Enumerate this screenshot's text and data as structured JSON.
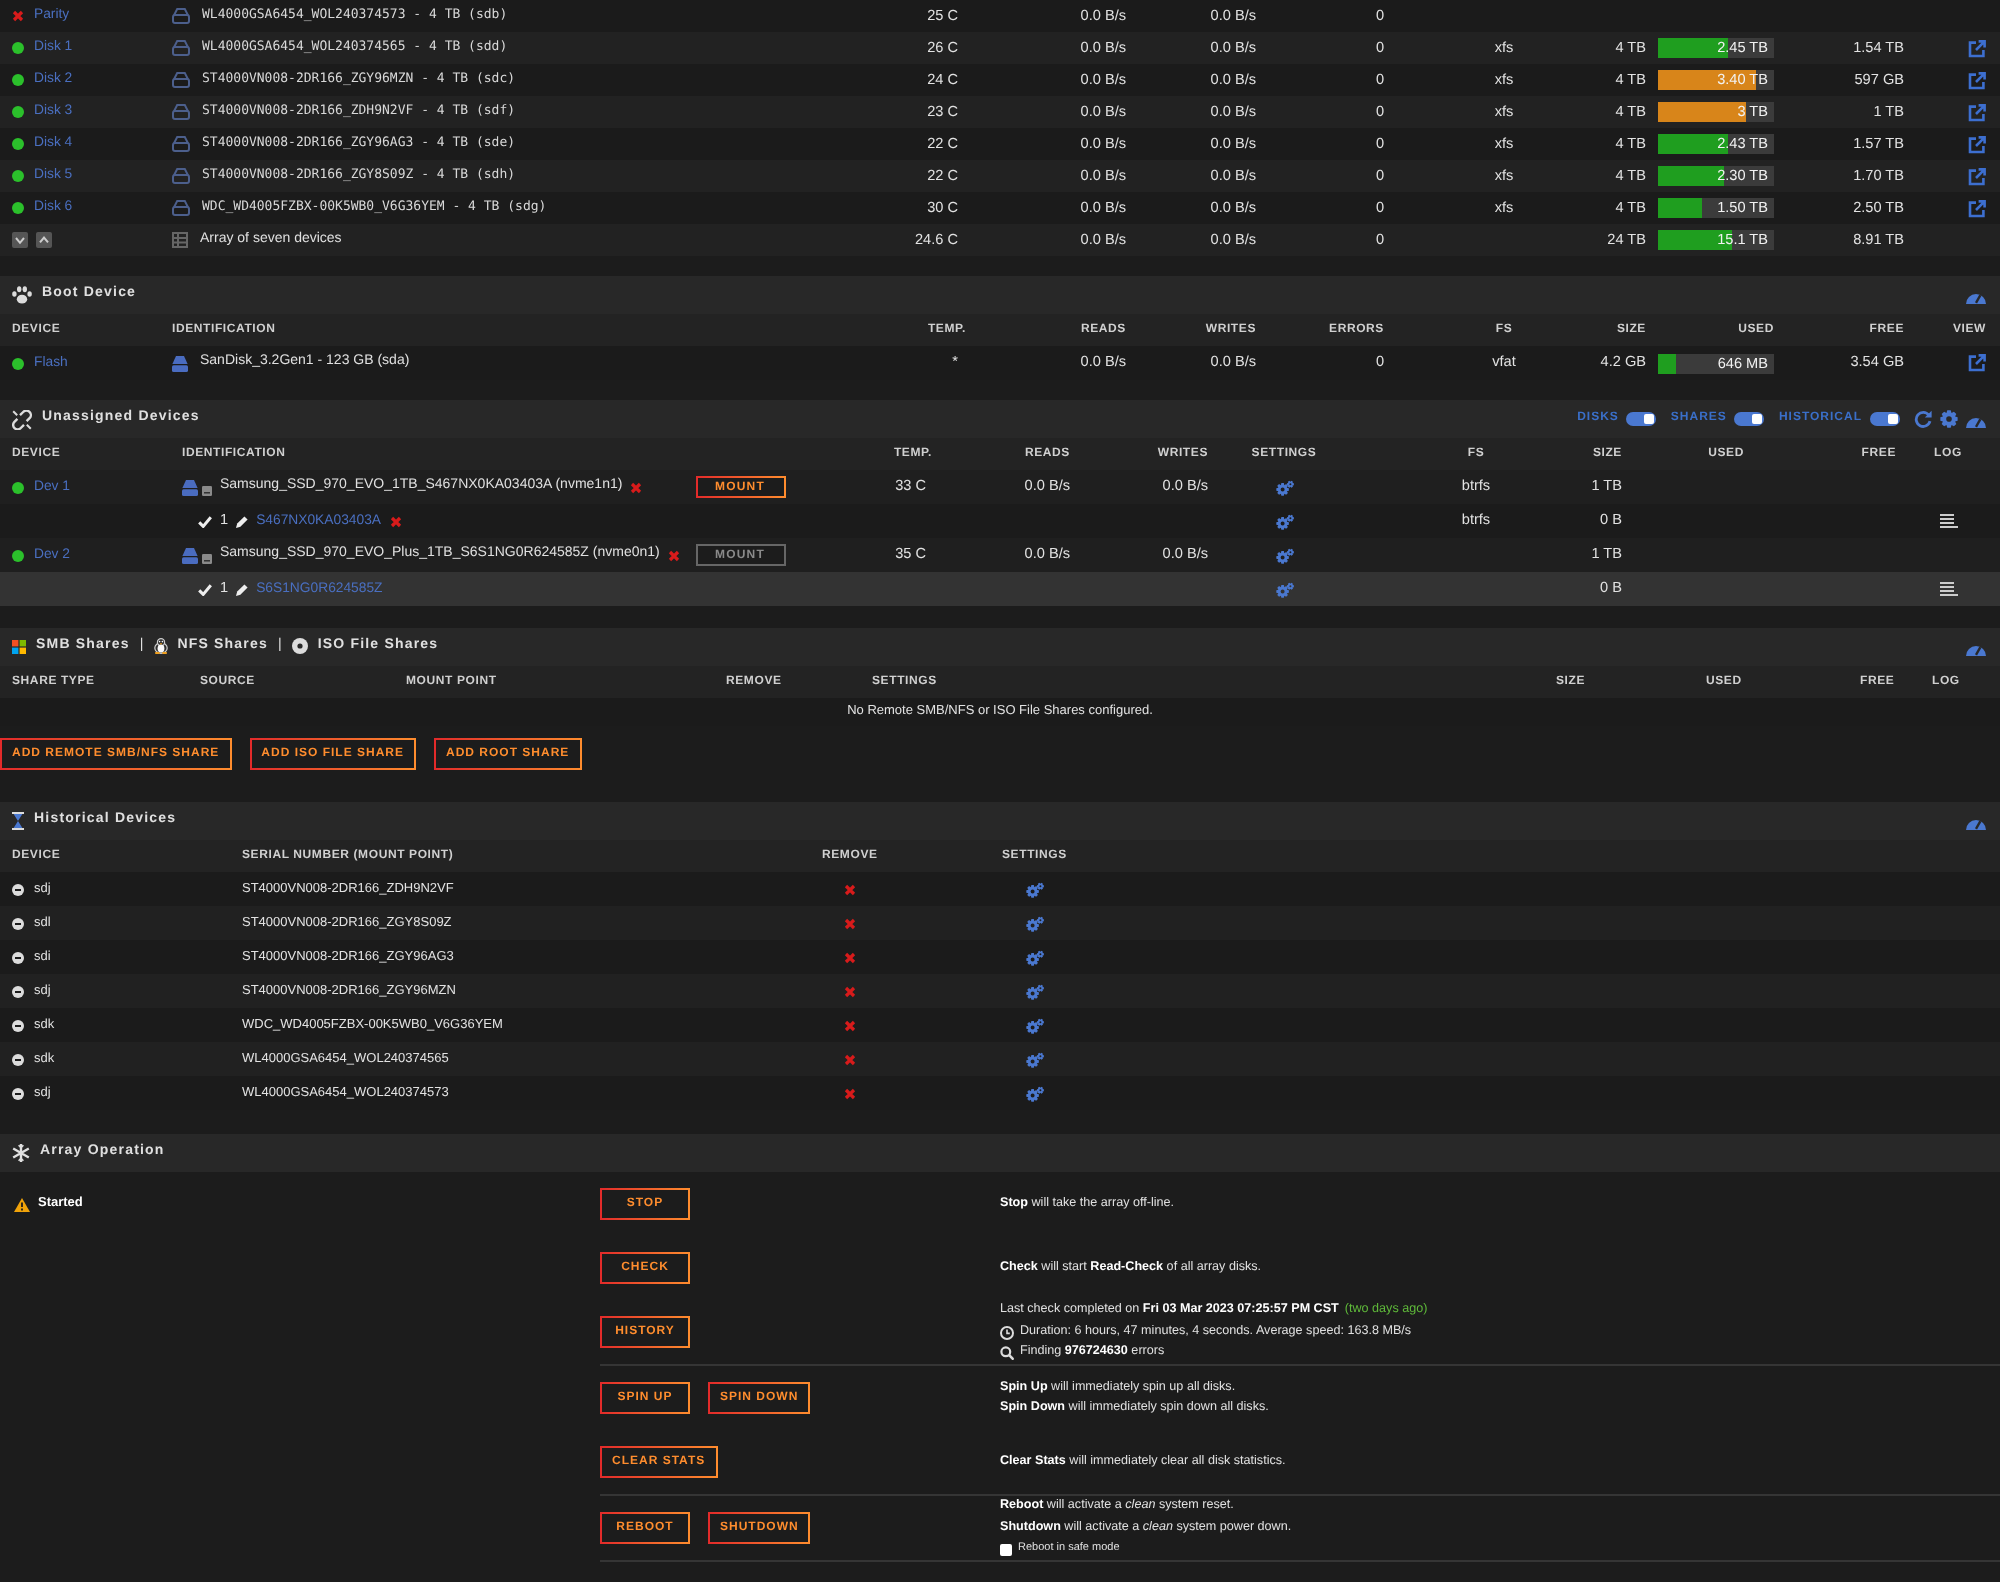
{
  "array": {
    "rows": [
      {
        "device": "Parity",
        "fault": true,
        "identification": "WL4000GSA6454_WOL240374573 - 4 TB (sdb)",
        "temp": "25 C",
        "reads": "0.0 B/s",
        "writes": "0.0 B/s",
        "errors": "0",
        "view": false
      },
      {
        "device": "Disk 1",
        "fault": false,
        "identification": "WL4000GSA6454_WOL240374565 - 4 TB (sdd)",
        "temp": "26 C",
        "reads": "0.0 B/s",
        "writes": "0.0 B/s",
        "errors": "0",
        "fs": "xfs",
        "size": "4 TB",
        "used": {
          "text": "2.45 TB",
          "level": 0.61,
          "color": "#1f9e1f"
        },
        "free": "1.54 TB",
        "view": true
      },
      {
        "device": "Disk 2",
        "fault": false,
        "identification": "ST4000VN008-2DR166_ZGY96MZN - 4 TB (sdc)",
        "temp": "24 C",
        "reads": "0.0 B/s",
        "writes": "0.0 B/s",
        "errors": "0",
        "fs": "xfs",
        "size": "4 TB",
        "used": {
          "text": "3.40 TB",
          "level": 0.85,
          "color": "#d8851a"
        },
        "free": "597 GB",
        "view": true
      },
      {
        "device": "Disk 3",
        "fault": false,
        "identification": "ST4000VN008-2DR166_ZDH9N2VF - 4 TB (sdf)",
        "temp": "23 C",
        "reads": "0.0 B/s",
        "writes": "0.0 B/s",
        "errors": "0",
        "fs": "xfs",
        "size": "4 TB",
        "used": {
          "text": "3 TB",
          "level": 0.75,
          "color": "#d8851a"
        },
        "free": "1 TB",
        "view": true
      },
      {
        "device": "Disk 4",
        "fault": false,
        "identification": "ST4000VN008-2DR166_ZGY96AG3 - 4 TB (sde)",
        "temp": "22 C",
        "reads": "0.0 B/s",
        "writes": "0.0 B/s",
        "errors": "0",
        "fs": "xfs",
        "size": "4 TB",
        "used": {
          "text": "2.43 TB",
          "level": 0.61,
          "color": "#1f9e1f"
        },
        "free": "1.57 TB",
        "view": true
      },
      {
        "device": "Disk 5",
        "fault": false,
        "identification": "ST4000VN008-2DR166_ZGY8S09Z - 4 TB (sdh)",
        "temp": "22 C",
        "reads": "0.0 B/s",
        "writes": "0.0 B/s",
        "errors": "0",
        "fs": "xfs",
        "size": "4 TB",
        "used": {
          "text": "2.30 TB",
          "level": 0.575,
          "color": "#1f9e1f"
        },
        "free": "1.70 TB",
        "view": true
      },
      {
        "device": "Disk 6",
        "fault": false,
        "identification": "WDC_WD4005FZBX-00K5WB0_V6G36YEM - 4 TB (sdg)",
        "temp": "30 C",
        "reads": "0.0 B/s",
        "writes": "0.0 B/s",
        "errors": "0",
        "fs": "xfs",
        "size": "4 TB",
        "used": {
          "text": "1.50 TB",
          "level": 0.375,
          "color": "#1f9e1f"
        },
        "free": "2.50 TB",
        "view": true
      }
    ],
    "total": {
      "label": "Array of seven devices",
      "temp": "24.6 C",
      "reads": "0.0 B/s",
      "writes": "0.0 B/s",
      "errors": "0",
      "size": "24 TB",
      "used": {
        "text": "15.1 TB",
        "level": 0.63,
        "color": "#1f9e1f"
      },
      "free": "8.91 TB"
    }
  },
  "boot": {
    "title": "Boot Device",
    "columns": [
      "DEVICE",
      "IDENTIFICATION",
      "TEMP.",
      "READS",
      "WRITES",
      "ERRORS",
      "FS",
      "SIZE",
      "USED",
      "FREE",
      "VIEW"
    ],
    "rows": [
      {
        "device": "Flash",
        "fault": false,
        "identification": "SanDisk_3.2Gen1 - 123 GB (sda)",
        "temp": "*",
        "reads": "0.0 B/s",
        "writes": "0.0 B/s",
        "errors": "0",
        "fs": "vfat",
        "size": "4.2 GB",
        "used": {
          "text": "646 MB",
          "level": 0.15,
          "color": "#1f9e1f"
        },
        "free": "3.54 GB",
        "view": true
      }
    ]
  },
  "unassigned": {
    "title": "Unassigned Devices",
    "toggles": [
      {
        "label": "DISKS",
        "on": true
      },
      {
        "label": "SHARES",
        "on": true
      },
      {
        "label": "HISTORICAL",
        "on": true
      }
    ],
    "columns": [
      "DEVICE",
      "IDENTIFICATION",
      "TEMP.",
      "READS",
      "WRITES",
      "SETTINGS",
      "FS",
      "SIZE",
      "USED",
      "FREE",
      "LOG"
    ],
    "devices": [
      {
        "device": "Dev 1",
        "fault": false,
        "identification": "Samsung_SSD_970_EVO_1TB_S467NX0KA03403A (nvme1n1)",
        "removable": true,
        "mount": {
          "label": "MOUNT",
          "disabled": false
        },
        "temp": "33 C",
        "reads": "0.0 B/s",
        "writes": "0.0 B/s",
        "fs": "btrfs",
        "size": "1 TB",
        "partitions": [
          {
            "number": "1",
            "label": "S467NX0KA03403A",
            "removable": true,
            "fs": "btrfs",
            "size": "0 B",
            "selected": false
          }
        ]
      },
      {
        "device": "Dev 2",
        "fault": false,
        "identification": "Samsung_SSD_970_EVO_Plus_1TB_S6S1NG0R624585Z (nvme0n1)",
        "removable": true,
        "mount": {
          "label": "MOUNT",
          "disabled": true
        },
        "temp": "35 C",
        "reads": "0.0 B/s",
        "writes": "0.0 B/s",
        "size": "1 TB",
        "partitions": [
          {
            "number": "1",
            "label": "S6S1NG0R624585Z",
            "removable": false,
            "size": "0 B",
            "selected": true
          }
        ]
      }
    ]
  },
  "shares": {
    "title_parts": [
      {
        "kind": "smb",
        "label": "SMB Shares"
      },
      {
        "kind": "separator",
        "label": "|"
      },
      {
        "kind": "nfs",
        "label": "NFS Shares"
      },
      {
        "kind": "separator",
        "label": "|"
      },
      {
        "kind": "iso",
        "label": "ISO File Shares"
      }
    ],
    "columns": [
      "SHARE TYPE",
      "SOURCE",
      "MOUNT POINT",
      "REMOVE",
      "SETTINGS",
      "SIZE",
      "USED",
      "FREE",
      "LOG"
    ],
    "empty_message": "No Remote SMB/NFS or ISO File Shares configured.",
    "buttons": [
      "ADD REMOTE SMB/NFS SHARE",
      "ADD ISO FILE SHARE",
      "ADD ROOT SHARE"
    ]
  },
  "historical": {
    "title": "Historical Devices",
    "columns": [
      "DEVICE",
      "SERIAL NUMBER (MOUNT POINT)",
      "REMOVE",
      "SETTINGS"
    ],
    "rows": [
      {
        "device": "sdj",
        "serial": "ST4000VN008-2DR166_ZDH9N2VF"
      },
      {
        "device": "sdl",
        "serial": "ST4000VN008-2DR166_ZGY8S09Z"
      },
      {
        "device": "sdi",
        "serial": "ST4000VN008-2DR166_ZGY96AG3"
      },
      {
        "device": "sdj",
        "serial": "ST4000VN008-2DR166_ZGY96MZN"
      },
      {
        "device": "sdk",
        "serial": "WDC_WD4005FZBX-00K5WB0_V6G36YEM"
      },
      {
        "device": "sdk",
        "serial": "WL4000GSA6454_WOL240374565"
      },
      {
        "device": "sdj",
        "serial": "WL4000GSA6454_WOL240374573"
      }
    ]
  },
  "operation": {
    "title": "Array Operation",
    "status": "Started",
    "groups": [
      {
        "rows": [
          {
            "buttons": [
              "STOP"
            ],
            "lines": [
              {
                "kind": "text",
                "text": "**Stop** will take the array off-line."
              }
            ]
          },
          {
            "buttons": [
              "CHECK"
            ],
            "lines": [
              {
                "kind": "text",
                "text": "**Check** will start **Read-Check** of all array disks."
              }
            ]
          },
          {
            "buttons": [
              "HISTORY"
            ],
            "lines": [
              {
                "kind": "text",
                "text": "Last check completed on **Fri 03 Mar 2023 07:25:57 PM CST**",
                "note": "(two days ago)"
              },
              {
                "kind": "duration",
                "text": "Duration: 6 hours, 47 minutes, 4 seconds. Average speed: 163.8 MB/s"
              },
              {
                "kind": "finding",
                "text": "Finding **976724630** errors"
              }
            ]
          }
        ]
      },
      {
        "rows": [
          {
            "buttons": [
              "SPIN UP",
              "SPIN DOWN"
            ],
            "lines": [
              {
                "kind": "text",
                "text": "**Spin Up** will immediately spin up all disks."
              },
              {
                "kind": "text",
                "text": "**Spin Down** will immediately spin down all disks."
              }
            ]
          },
          {
            "buttons": [
              "CLEAR STATS"
            ],
            "lines": [
              {
                "kind": "text",
                "text": "**Clear Stats** will immediately clear all disk statistics."
              }
            ]
          }
        ]
      },
      {
        "rows": [
          {
            "buttons": [
              "REBOOT",
              "SHUTDOWN"
            ],
            "lines": [
              {
                "kind": "text",
                "text": "**Reboot** will activate a *clean* system reset."
              },
              {
                "kind": "text",
                "text": "**Shutdown** will activate a *clean* system power down."
              },
              {
                "kind": "checkbox",
                "text": "Reboot in safe mode",
                "checked": false
              }
            ]
          }
        ]
      }
    ]
  }
}
